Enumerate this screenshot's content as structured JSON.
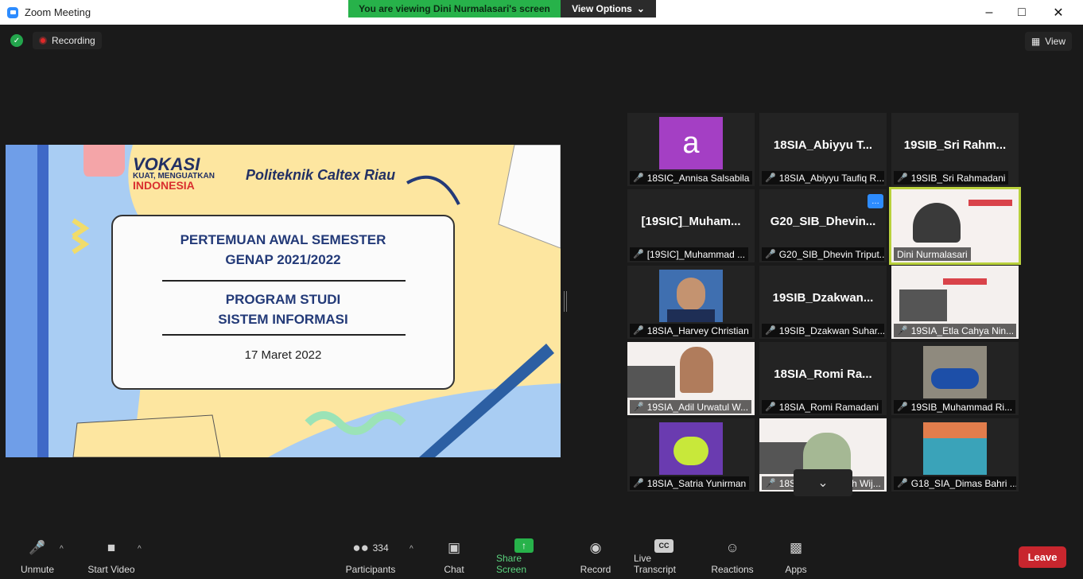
{
  "window": {
    "title": "Zoom Meeting"
  },
  "banner": {
    "viewing_text": "You are viewing Dini Nurmalasari's screen",
    "view_options": "View Options"
  },
  "topbar": {
    "recording": "Recording",
    "view": "View"
  },
  "slide": {
    "logo_vokasi": "VOKASI",
    "logo_tagline": "KUAT, MENGUATKAN",
    "logo_indonesia": "INDONESIA",
    "college": "Politeknik Caltex Riau",
    "line1": "PERTEMUAN AWAL SEMESTER",
    "line2": "GENAP 2021/2022",
    "line3": "PROGRAM STUDI",
    "line4": "SISTEM INFORMASI",
    "date": "17 Maret 2022"
  },
  "gallery": [
    {
      "name": "18SIC_Annisa Salsabila",
      "big": "",
      "avatar": "a"
    },
    {
      "name": "18SIA_Abiyyu Taufiq R...",
      "big": "18SIA_Abiyyu T..."
    },
    {
      "name": "19SIB_Sri Rahmadani",
      "big": "19SIB_Sri Rahm..."
    },
    {
      "name": "[19SIC]_Muhammad ...",
      "big": "[19SIC]_Muham..."
    },
    {
      "name": "G20_SIB_Dhevin Triput...",
      "big": "G20_SIB_Dhevin..."
    },
    {
      "name": "Dini Nurmalasari",
      "big": ""
    },
    {
      "name": "18SIA_Harvey Christian",
      "big": ""
    },
    {
      "name": "19SIB_Dzakwan Suhar...",
      "big": "19SIB_Dzakwan..."
    },
    {
      "name": "19SIA_Etla Cahya Nin...",
      "big": ""
    },
    {
      "name": "19SIA_Adil Urwatul W...",
      "big": ""
    },
    {
      "name": "18SIA_Romi Ramadani",
      "big": "18SIA_Romi Ra..."
    },
    {
      "name": "19SIB_Muhammad Ri...",
      "big": ""
    },
    {
      "name": "18SIA_Satria Yunirman",
      "big": ""
    },
    {
      "name": "18SIC_Putri Indah Wij...",
      "big": ""
    },
    {
      "name": "G18_SIA_Dimas Bahri ...",
      "big": ""
    }
  ],
  "toolbar": {
    "unmute": "Unmute",
    "start_video": "Start Video",
    "participants": "Participants",
    "participants_count": "334",
    "chat": "Chat",
    "share_screen": "Share Screen",
    "record": "Record",
    "live_transcript": "Live Transcript",
    "reactions": "Reactions",
    "apps": "Apps",
    "leave": "Leave"
  },
  "colors": {
    "share_green": "#27b24a",
    "leave_red": "#c8262e",
    "active_speaker": "#b9d13c",
    "slide_navy": "#233a78"
  }
}
